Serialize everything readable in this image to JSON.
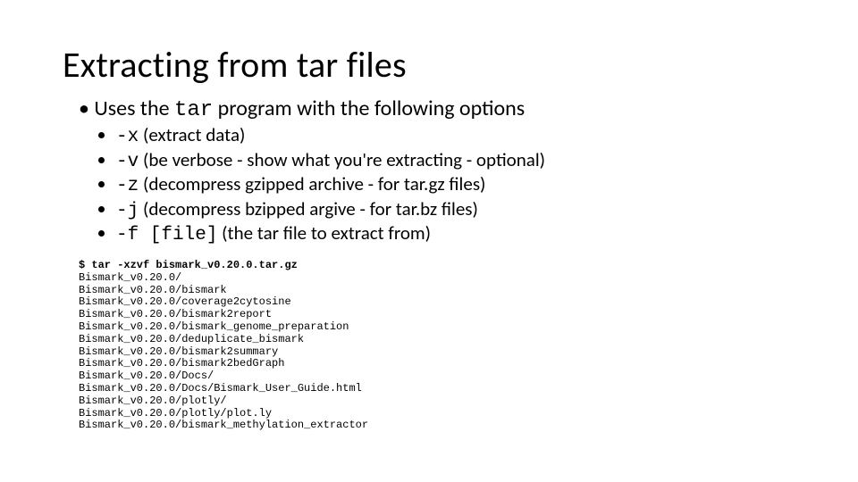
{
  "title": "Extracting from tar files",
  "line1_pre": "Uses the ",
  "line1_code": "tar",
  "line1_post": " program with the following options",
  "options": [
    {
      "flag": "-x",
      "desc": " (extract data)"
    },
    {
      "flag": "-v",
      "desc": " (be verbose - show what you're extracting - optional)"
    },
    {
      "flag": "-z",
      "desc": " (decompress gzipped archive - for tar.gz files)"
    },
    {
      "flag": "-j",
      "desc": " (decompress bzipped argive - for tar.bz files)"
    },
    {
      "flag": "-f [file]",
      "desc": "  (the tar file to extract from)"
    }
  ],
  "terminal": {
    "cmd": "$ tar -xzvf bismark_v0.20.0.tar.gz",
    "out": [
      "Bismark_v0.20.0/",
      "Bismark_v0.20.0/bismark",
      "Bismark_v0.20.0/coverage2cytosine",
      "Bismark_v0.20.0/bismark2report",
      "Bismark_v0.20.0/bismark_genome_preparation",
      "Bismark_v0.20.0/deduplicate_bismark",
      "Bismark_v0.20.0/bismark2summary",
      "Bismark_v0.20.0/bismark2bedGraph",
      "Bismark_v0.20.0/Docs/",
      "Bismark_v0.20.0/Docs/Bismark_User_Guide.html",
      "Bismark_v0.20.0/plotly/",
      "Bismark_v0.20.0/plotly/plot.ly",
      "Bismark_v0.20.0/bismark_methylation_extractor"
    ]
  }
}
